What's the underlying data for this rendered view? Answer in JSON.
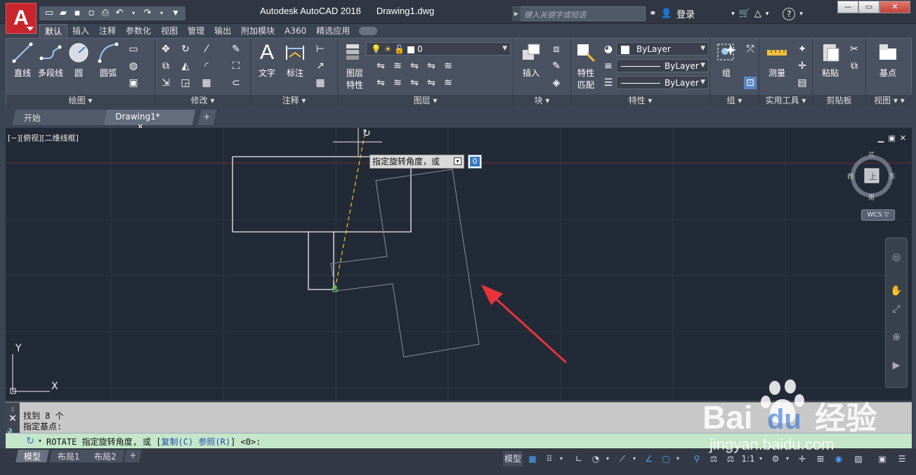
{
  "window": {
    "app_title": "Autodesk AutoCAD 2018",
    "doc_title": "Drawing1.dwg",
    "search_placeholder": "键入关键字或短语",
    "login_label": "登录",
    "help_label": "?"
  },
  "app_logo_letter": "A",
  "ribbon_tabs": [
    "默认",
    "插入",
    "注释",
    "参数化",
    "视图",
    "管理",
    "输出",
    "附加模块",
    "A360",
    "精选应用"
  ],
  "panels": {
    "draw": {
      "title": "绘图",
      "line": "直线",
      "polyline": "多段线",
      "circle": "圆",
      "arc": "圆弧"
    },
    "modify": {
      "title": "修改"
    },
    "annotation": {
      "title": "注释",
      "text": "文字",
      "dimension": "标注"
    },
    "layers": {
      "title": "图层",
      "layer_props_1": "图层",
      "layer_props_2": "特性",
      "current_layer": "0"
    },
    "block": {
      "title": "块",
      "insert": "插入"
    },
    "properties": {
      "title": "特性",
      "match_1": "特性",
      "match_2": "匹配",
      "color": "ByLayer",
      "linetype": "ByLayer",
      "lineweight": "ByLayer"
    },
    "groups": {
      "title": "组",
      "group": "组"
    },
    "utilities": {
      "title": "实用工具",
      "measure": "测量"
    },
    "clipboard": {
      "title": "剪贴板",
      "paste": "粘贴"
    },
    "view": {
      "title": "视图",
      "base": "基点"
    }
  },
  "doc_tabs": [
    "开始",
    "Drawing1*"
  ],
  "viewport": {
    "label": "[−][俯视][二维线框]",
    "compass": {
      "n": "北",
      "s": "南",
      "e": "东",
      "w": "西",
      "top": "上"
    },
    "wcs": "WCS",
    "tooltip_text": "指定旋转角度，或",
    "dyn_input_value": "0",
    "ucs_x": "X",
    "ucs_y": "Y"
  },
  "command": {
    "history": [
      "找到 8 个",
      "指定基点:"
    ],
    "prompt_cmd": "ROTATE",
    "prompt_text": " 指定旋转角度, 或 [",
    "opt_copy": "复制(C)",
    "opt_ref": "参照(R)",
    "prompt_end": "] <0>:"
  },
  "layout_tabs": [
    "模型",
    "布局1",
    "布局2"
  ],
  "status": {
    "model": "模型",
    "scale": "1:1"
  },
  "watermark": {
    "brand": "Bai",
    "brand2": "du",
    "cn": "经验",
    "url": "jingyan.baidu.com"
  },
  "colors": {
    "accent_red": "#c7262c",
    "canvas": "#232a37",
    "cmd_green": "#c5e7c9"
  }
}
